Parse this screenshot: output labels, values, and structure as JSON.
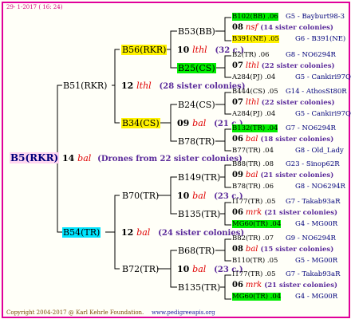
{
  "header": {
    "date": "29- 1-2017 ( 16: 24)"
  },
  "footer": {
    "copyright": "Copyright 2004-2017 @ Karl Kehrle Foundation.",
    "site": "www.pedigreeapis.org"
  },
  "root": {
    "label": "B5(RKR)",
    "gen": "14",
    "mark": "bal",
    "note": "(Drones from 22 sister colonies)"
  },
  "g1": [
    {
      "label": "B51(RKR)",
      "gen": "12",
      "mark": "lthl",
      "note": "(28 sister colonies)"
    },
    {
      "label": "B54(TR)",
      "gen": "12",
      "mark": "bal",
      "note": "(24 sister colonies)"
    }
  ],
  "g2": [
    {
      "label": "B56(RKR)",
      "gen": "10",
      "mark": "lthl",
      "note": "(32 c.)"
    },
    {
      "label": "B34(CS)",
      "gen": "09",
      "mark": "bal",
      "note": "(21 c.)"
    },
    {
      "label": "B70(TR)",
      "gen": "10",
      "mark": "bal",
      "note": "(23 c.)"
    },
    {
      "label": "B72(TR)",
      "gen": "10",
      "mark": "bal",
      "note": "(23 c.)"
    }
  ],
  "g3": [
    {
      "label": "B53(BB)"
    },
    {
      "label": "B25(CS)"
    },
    {
      "label": "B24(CS)"
    },
    {
      "label": "B78(TR)"
    },
    {
      "label": "B149(TR)"
    },
    {
      "label": "B135(TR)"
    },
    {
      "label": "B68(TR)"
    },
    {
      "label": "B135(TR)"
    }
  ],
  "g4": [
    {
      "top": "B102(BB) .06",
      "top_right": "G5 - Bayburt98-3",
      "gen": "08",
      "mark": "nsf",
      "note": "(14 sister colonies)",
      "bot": "B391(NE) .05",
      "bot_right": "G6 - B391(NE)"
    },
    {
      "top": "B2(TR) .06",
      "top_right": "G8 - NO6294R",
      "gen": "07",
      "mark": "lthl",
      "note": "(22 sister colonies)",
      "bot": "A284(PJ) .04",
      "bot_right": "G5 - Cankiri97Q"
    },
    {
      "top": "B444(CS) .05",
      "top_right": "G14 - AthosSt80R",
      "gen": "07",
      "mark": "lthl",
      "note": "(22 sister colonies)",
      "bot": "A284(PJ) .04",
      "bot_right": "G5 - Cankiri97Q"
    },
    {
      "top": "B132(TR) .04",
      "top_right": "G7 - NO6294R",
      "gen": "06",
      "mark": "bal",
      "note": "(18 sister colonies)",
      "bot": "B77(TR) .04",
      "bot_right": "G8 - Old_Lady"
    },
    {
      "top": "B88(TR) .08",
      "top_right": "G23 - Sinop62R",
      "gen": "09",
      "mark": "bal",
      "note": "(21 sister colonies)",
      "bot": "B78(TR) .06",
      "bot_right": "G8 - NO6294R"
    },
    {
      "top": "I177(TR) .05",
      "top_right": "G7 - Takab93aR",
      "gen": "06",
      "mark": "mrk",
      "note": "(21 sister colonies)",
      "bot": "MG60(TR) .04",
      "bot_right": "G4 - MG00R"
    },
    {
      "top": "B82(TR) .07",
      "top_right": "G9 - NO6294R",
      "gen": "08",
      "mark": "bal",
      "note": "(15 sister colonies)",
      "bot": "B110(TR) .05",
      "bot_right": "G5 - MG00R"
    },
    {
      "top": "I177(TR) .05",
      "top_right": "G7 - Takab93aR",
      "gen": "06",
      "mark": "mrk",
      "note": "(21 sister colonies)",
      "bot": "MG60(TR) .04",
      "bot_right": "G4 - MG00R"
    }
  ],
  "colors": {
    "border": "#e0009a",
    "yellow": "#fff200",
    "green": "#00ee00",
    "cyan": "#00e5ff",
    "pink": "#ffd6f0",
    "mark": "#e00000",
    "note": "#5a2a9a"
  }
}
